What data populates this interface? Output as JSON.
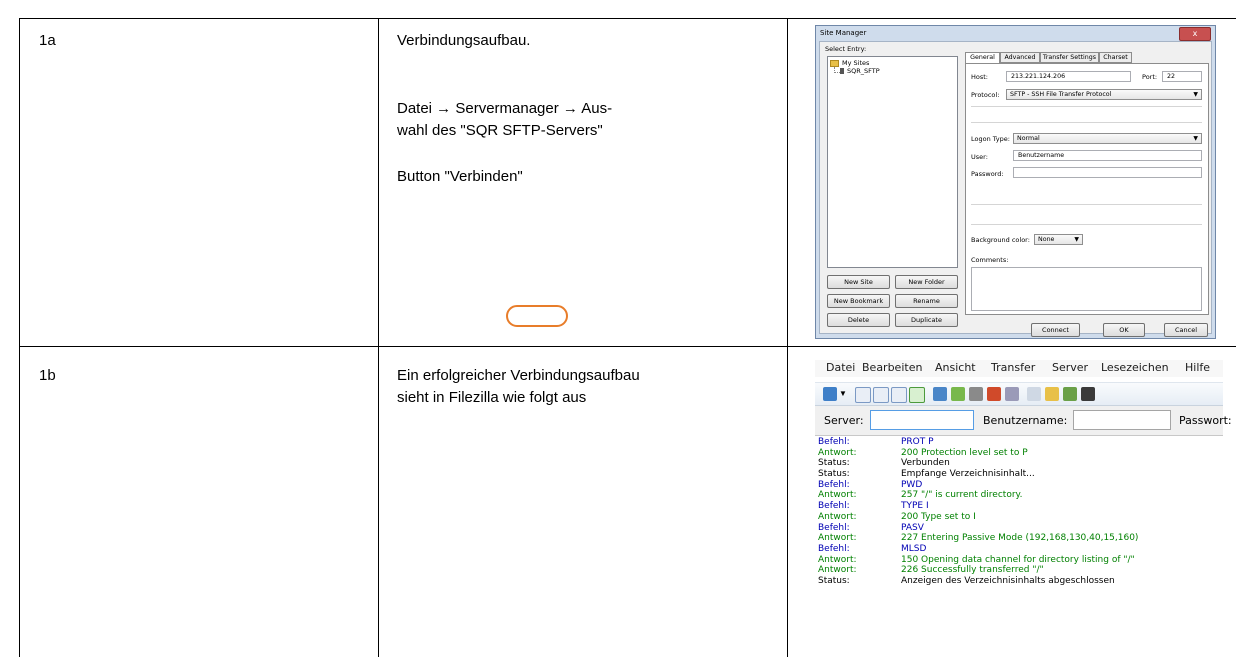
{
  "rows": [
    {
      "id": "1a",
      "lines": [
        "Verbindungsaufbau.",
        "Datei → Servermanager → Aus-",
        "wahl des \"SQR SFTP-Servers\"",
        "Button \"Verbinden\""
      ]
    },
    {
      "id": "1b",
      "lines": [
        "Ein erfolgreicher Verbindungsaufbau",
        "sieht in Filezilla wie folgt aus"
      ]
    }
  ],
  "site_manager": {
    "title": "Site Manager",
    "close_glyph": "x",
    "select_entry_label": "Select Entry:",
    "tree": {
      "root": "My Sites",
      "child": "SQR_SFTP"
    },
    "buttons": {
      "new_site": "New Site",
      "new_folder": "New Folder",
      "new_bookmark": "New Bookmark",
      "rename": "Rename",
      "delete": "Delete",
      "duplicate": "Duplicate",
      "connect": "Connect",
      "ok": "OK",
      "cancel": "Cancel"
    },
    "tabs": [
      "General",
      "Advanced",
      "Transfer Settings",
      "Charset"
    ],
    "labels": {
      "host": "Host:",
      "port": "Port:",
      "protocol": "Protocol:",
      "logon_type": "Logon Type:",
      "user": "User:",
      "password": "Password:",
      "background_color": "Background color:",
      "comments": "Comments:"
    },
    "values": {
      "host": "213.221.124.206",
      "port": "22",
      "protocol": "SFTP - SSH File Transfer Protocol",
      "logon_type": "Normal",
      "user": "Benutzername",
      "password": "",
      "background_color": "None",
      "comments": ""
    },
    "highlight_color": "#e87d2a"
  },
  "filezilla": {
    "menu": [
      "Datei",
      "Bearbeiten",
      "Ansicht",
      "Transfer",
      "Server",
      "Lesezeichen",
      "Hilfe"
    ],
    "quickconnect": {
      "server_label": "Server:",
      "user_label": "Benutzername:",
      "password_label": "Passwort:"
    },
    "colors": {
      "befehl": "#0000b4",
      "antwort": "#008000",
      "status": "#000000"
    },
    "log": [
      {
        "type": "befehl",
        "label": "Befehl:",
        "text": "PROT P"
      },
      {
        "type": "antwort",
        "label": "Antwort:",
        "text": "200 Protection level set to P"
      },
      {
        "type": "status",
        "label": "Status:",
        "text": "Verbunden"
      },
      {
        "type": "status",
        "label": "Status:",
        "text": "Empfange Verzeichnisinhalt..."
      },
      {
        "type": "befehl",
        "label": "Befehl:",
        "text": "PWD"
      },
      {
        "type": "antwort",
        "label": "Antwort:",
        "text": "257 \"/\" is current directory."
      },
      {
        "type": "befehl",
        "label": "Befehl:",
        "text": "TYPE I"
      },
      {
        "type": "antwort",
        "label": "Antwort:",
        "text": "200 Type set to I"
      },
      {
        "type": "befehl",
        "label": "Befehl:",
        "text": "PASV"
      },
      {
        "type": "antwort",
        "label": "Antwort:",
        "text": "227 Entering Passive Mode (192,168,130,40,15,160)"
      },
      {
        "type": "befehl",
        "label": "Befehl:",
        "text": "MLSD"
      },
      {
        "type": "antwort",
        "label": "Antwort:",
        "text": "150 Opening data channel for directory listing of \"/\""
      },
      {
        "type": "antwort",
        "label": "Antwort:",
        "text": "226 Successfully transferred \"/\""
      },
      {
        "type": "status",
        "label": "Status:",
        "text": "Anzeigen des Verzeichnisinhalts abgeschlossen"
      }
    ]
  }
}
